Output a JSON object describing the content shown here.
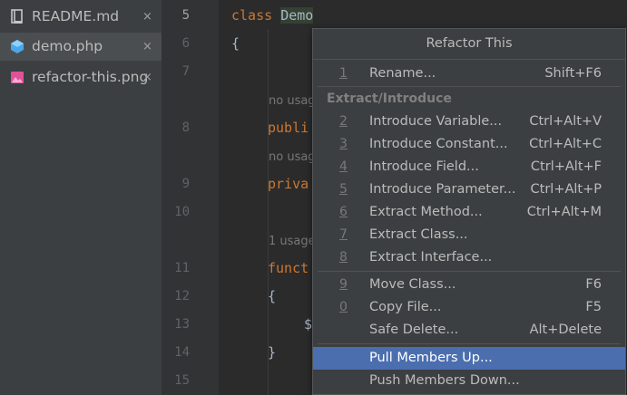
{
  "file_tabs": [
    {
      "name": "README.md",
      "icon": "markdown-file-icon",
      "active": false
    },
    {
      "name": "demo.php",
      "icon": "php-file-icon",
      "active": true
    },
    {
      "name": "refactor-this.png",
      "icon": "image-file-icon",
      "active": false
    }
  ],
  "close_glyph": "×",
  "line_numbers": [
    "5",
    "6",
    "7",
    "8",
    "9",
    "10",
    "11",
    "12",
    "13",
    "14",
    "15"
  ],
  "code": {
    "line5_kw": "class",
    "line5_name": "Demo",
    "line6": "{",
    "hint1": "no usages",
    "line8_kw": "publi",
    "hint2": "no usag",
    "line9_kw": "priva",
    "hint3": "1 usage",
    "line11_kw": "funct",
    "line12": "{",
    "line13": "$",
    "line14": "}"
  },
  "popup": {
    "title": "Refactor This",
    "items": [
      {
        "num": "1",
        "label": "Rename...",
        "shortcut": "Shift+F6"
      },
      {
        "group": "Extract/Introduce"
      },
      {
        "num": "2",
        "label": "Introduce Variable...",
        "shortcut": "Ctrl+Alt+V"
      },
      {
        "num": "3",
        "label": "Introduce Constant...",
        "shortcut": "Ctrl+Alt+C"
      },
      {
        "num": "4",
        "label": "Introduce Field...",
        "shortcut": "Ctrl+Alt+F"
      },
      {
        "num": "5",
        "label": "Introduce Parameter...",
        "shortcut": "Ctrl+Alt+P"
      },
      {
        "num": "6",
        "label": "Extract Method...",
        "shortcut": "Ctrl+Alt+M"
      },
      {
        "num": "7",
        "label": "Extract Class...",
        "shortcut": ""
      },
      {
        "num": "8",
        "label": "Extract Interface...",
        "shortcut": ""
      },
      {
        "num": "9",
        "label": "Move Class...",
        "shortcut": "F6"
      },
      {
        "num": "0",
        "label": "Copy File...",
        "shortcut": "F5"
      },
      {
        "num": "",
        "label": "Safe Delete...",
        "shortcut": "Alt+Delete"
      },
      {
        "num": "",
        "label": "Pull Members Up...",
        "shortcut": "",
        "selected": true
      },
      {
        "num": "",
        "label": "Push Members Down...",
        "shortcut": ""
      }
    ]
  },
  "colors": {
    "keyword": "#cc7832",
    "selection": "#4b6eaf",
    "php_icon": "#4aa8e8",
    "image_icon": "#e05297"
  }
}
